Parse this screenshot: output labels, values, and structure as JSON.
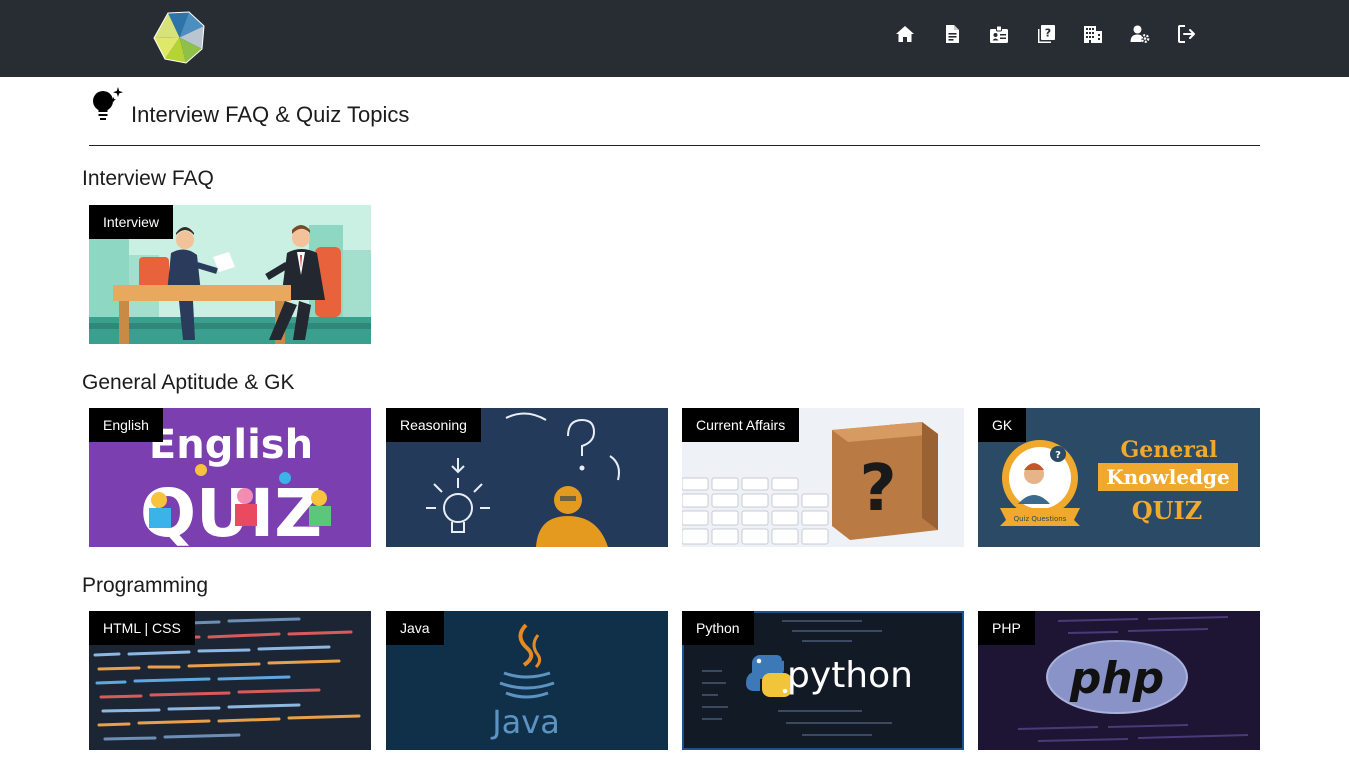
{
  "header": {
    "logo": "hexagon-logo",
    "nav_icons": [
      "home-icon",
      "document-icon",
      "id-card-icon",
      "question-book-icon",
      "building-icon",
      "user-gear-icon",
      "logout-icon"
    ]
  },
  "page": {
    "title": "Interview FAQ & Quiz Topics",
    "icon": "lightbulb-sparkle-icon"
  },
  "sections": [
    {
      "title": "Interview FAQ",
      "cards": [
        {
          "label": "Interview"
        }
      ]
    },
    {
      "title": "General Aptitude & GK",
      "cards": [
        {
          "label": "English",
          "art_title_1": "English",
          "art_title_2": "QUIZ"
        },
        {
          "label": "Reasoning"
        },
        {
          "label": "Current Affairs",
          "art_symbol": "?"
        },
        {
          "label": "GK",
          "art_line_1": "General",
          "art_line_2": "Knowledge",
          "art_line_3": "QUIZ",
          "art_badge": "Quiz Questions"
        }
      ]
    },
    {
      "title": "Programming",
      "cards": [
        {
          "label": "HTML | CSS"
        },
        {
          "label": "Java",
          "art_text": "Java"
        },
        {
          "label": "Python",
          "art_text": "python"
        },
        {
          "label": "PHP",
          "art_text": "php"
        }
      ]
    }
  ],
  "colors": {
    "topbar": "#282c33",
    "tag_bg": "#000000",
    "english_purple": "#7b3fb0",
    "gk_navy": "#2a4a66",
    "gk_gold": "#f0a92c"
  }
}
